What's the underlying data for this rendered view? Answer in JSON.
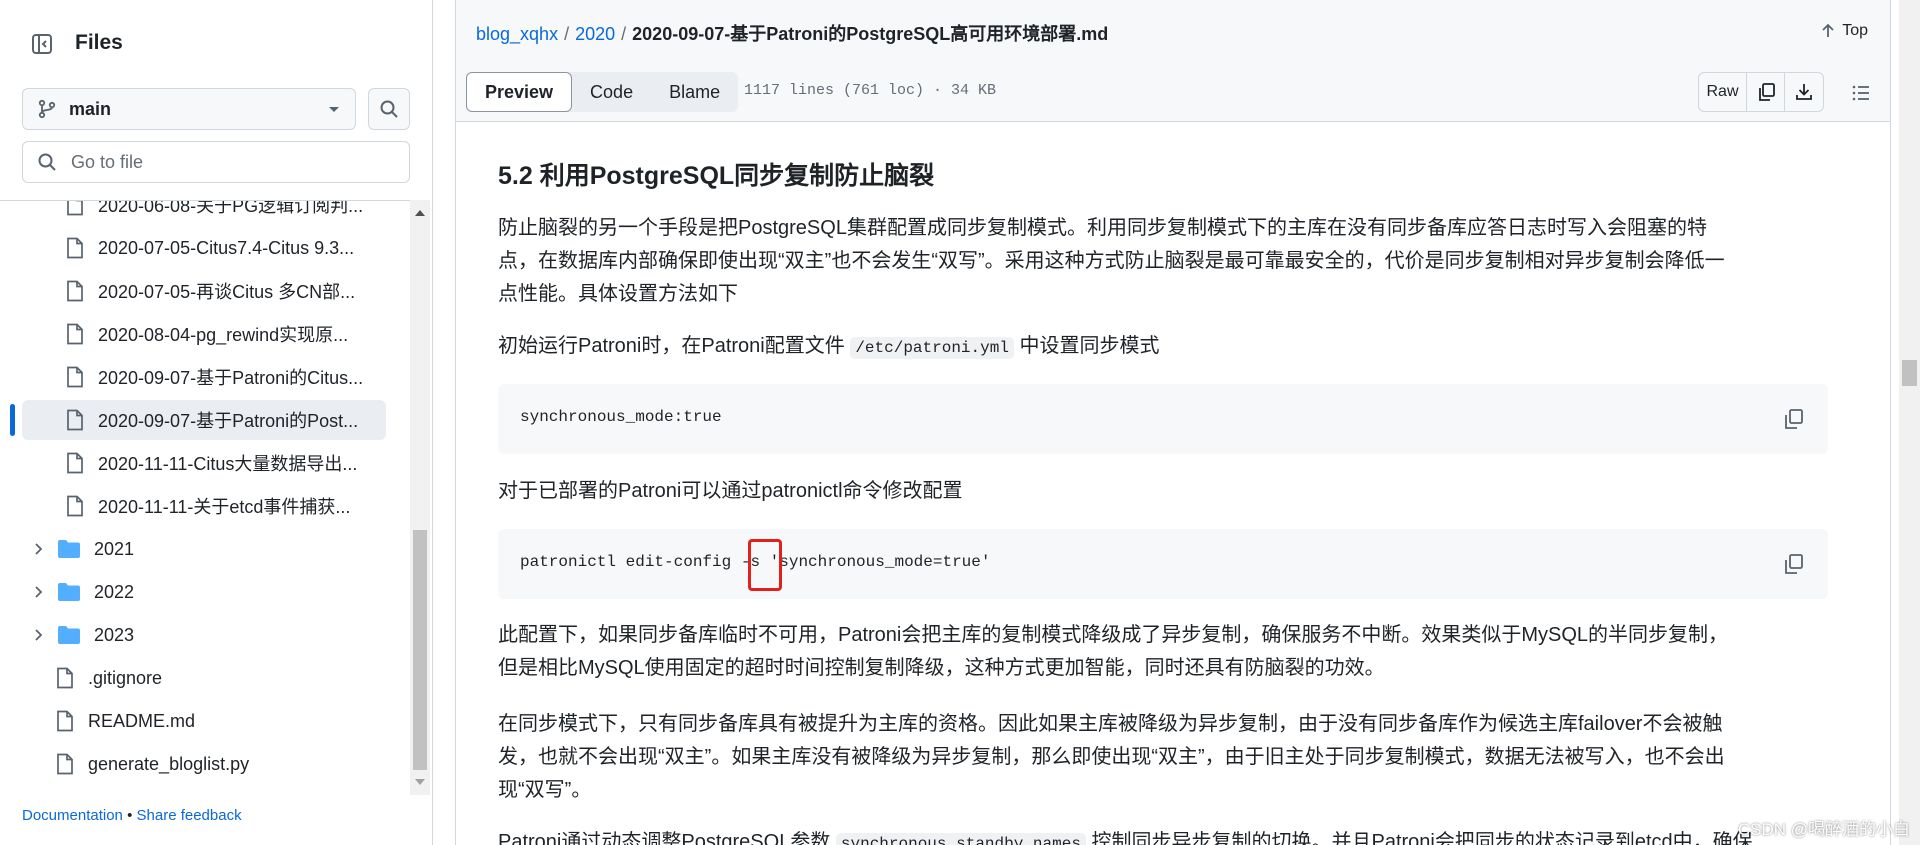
{
  "sidebar": {
    "title": "Files",
    "branch": "main",
    "goto_placeholder": "Go to file",
    "items": [
      {
        "label": "2020-06-08-关于PG逻辑订阅判...",
        "kind": "file",
        "active": false
      },
      {
        "label": "2020-07-05-Citus7.4-Citus 9.3...",
        "kind": "file",
        "active": false
      },
      {
        "label": "2020-07-05-再谈Citus 多CN部...",
        "kind": "file",
        "active": false
      },
      {
        "label": "2020-08-04-pg_rewind实现原...",
        "kind": "file",
        "active": false
      },
      {
        "label": "2020-09-07-基于Patroni的Citus...",
        "kind": "file",
        "active": false
      },
      {
        "label": "2020-09-07-基于Patroni的Post...",
        "kind": "file",
        "active": true
      },
      {
        "label": "2020-11-11-Citus大量数据导出...",
        "kind": "file",
        "active": false
      },
      {
        "label": "2020-11-11-关于etcd事件捕获...",
        "kind": "file",
        "active": false
      },
      {
        "label": "2021",
        "kind": "folder",
        "active": false
      },
      {
        "label": "2022",
        "kind": "folder",
        "active": false
      },
      {
        "label": "2023",
        "kind": "folder",
        "active": false
      },
      {
        "label": ".gitignore",
        "kind": "rootfile",
        "active": false
      },
      {
        "label": "README.md",
        "kind": "rootfile",
        "active": false
      },
      {
        "label": "generate_bloglist.py",
        "kind": "rootfile",
        "active": false
      }
    ],
    "footer": {
      "documentation": "Documentation",
      "bullet": "•",
      "feedback": "Share feedback"
    }
  },
  "header": {
    "breadcrumb": {
      "repo": "blog_xqhx",
      "sep": "/",
      "folder": "2020",
      "file": "2020-09-07-基于Patroni的PostgreSQL高可用环境部署.md"
    },
    "top_label": "Top",
    "tabs": [
      "Preview",
      "Code",
      "Blame"
    ],
    "selected_tab": "Preview",
    "meta": "1117 lines (761 loc) · 34 KB",
    "raw_label": "Raw"
  },
  "doc": {
    "heading": "5.2 利用PostgreSQL同步复制防止脑裂",
    "p1": [
      "防止脑裂的另一个手段是把PostgreSQL集群配置成同步复制模式。利用同步复制模式下的主库在没有同步备库应答日志时写入会阻塞的特",
      "点，在数据库内部确保即使出现“双主”也不会发生“双写”。采用这种方式防止脑裂是最可靠最安全的，代价是同步复制相对异步复制会降低一",
      "点性能。具体设置方法如下"
    ],
    "p2_before": "初始运行Patroni时，在Patroni配置文件",
    "p2_code": "/etc/patroni.yml",
    "p2_after": "中设置同步模式",
    "code1": "synchronous_mode:true",
    "p3": "对于已部署的Patroni可以通过patronictl命令修改配置",
    "code2": "patronictl edit-config -s 'synchronous_mode=true'",
    "p4": [
      "此配置下，如果同步备库临时不可用，Patroni会把主库的复制模式降级成了异步复制，确保服务不中断。效果类似于MySQL的半同步复制，",
      "但是相比MySQL使用固定的超时时间控制复制降级，这种方式更加智能，同时还具有防脑裂的功效。"
    ],
    "p5": [
      "在同步模式下，只有同步备库具有被提升为主库的资格。因此如果主库被降级为异步复制，由于没有同步备库作为候选主库failover不会被触",
      "发，也就不会出现“双主”。如果主库没有被降级为异步复制，那么即使出现“双主”，由于旧主处于同步复制模式，数据无法被写入，也不会出",
      "现“双写”。"
    ],
    "p6_before": "Patroni通过动态调整PostgreSQL参数",
    "p6_code": "synchronous_standby_names",
    "p6_after": "控制同步异步复制的切换。并且Patroni会把同步的状态记录到etcd中，确保"
  },
  "watermark": "CSDN @喝醉酒的小白",
  "colors": {
    "accent": "#0969da",
    "highlight": "#e5201c",
    "folder": "#54aeff"
  }
}
